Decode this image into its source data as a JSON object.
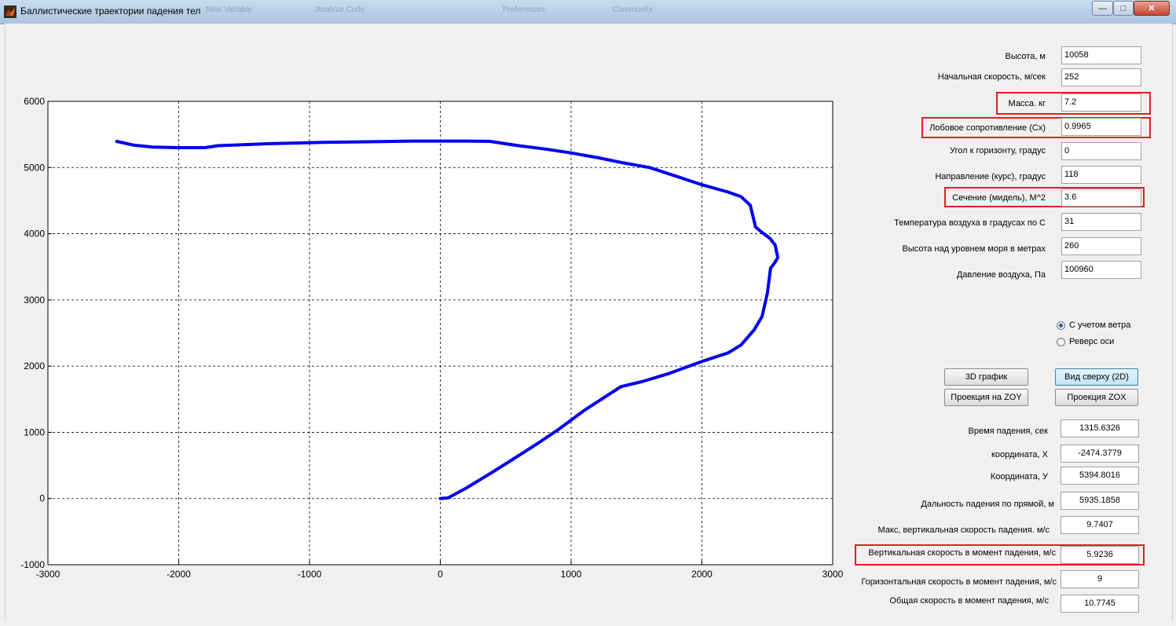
{
  "window": {
    "title": "Баллистические траектории падения тел",
    "bg_menu_items": [
      "New Variable",
      "Analyze Code",
      "Preferences",
      "Community"
    ],
    "controls": {
      "minimize": "—",
      "maximize": "□",
      "close": "✕"
    }
  },
  "inputs": [
    {
      "label": "Высота, м",
      "value": "10058"
    },
    {
      "label": "Начальная скорость, м/сек",
      "value": "252"
    },
    {
      "label": "Масса. кг",
      "value": "7.2"
    },
    {
      "label": "Лобовое сопротивление (Cx)",
      "value": "0.9965"
    },
    {
      "label": "Угол к горизонту, градус",
      "value": "0"
    },
    {
      "label": "Направление  (курс), градус",
      "value": "118"
    },
    {
      "label": "Сечение (мидель), М^2",
      "value": "3.6"
    },
    {
      "label": "Температура воздуха в градусах по С",
      "value": "31"
    },
    {
      "label": "Высота над уровнем моря в метрах",
      "value": "260"
    },
    {
      "label": "Давление воздуха, Па",
      "value": "100960"
    }
  ],
  "options": {
    "wind": {
      "label": "С учетом ветра",
      "checked": true
    },
    "reverse": {
      "label": "Реверс оси",
      "checked": false
    }
  },
  "buttons": {
    "plot3d": "3D график",
    "top_view": "Вид сверху (2D)",
    "zoy": "Проекция на ZOY",
    "zox": "Проекция ZOX"
  },
  "outputs": [
    {
      "label": "Время падения, сек",
      "value": "1315.6326"
    },
    {
      "label": "координата, X",
      "value": "-2474.3779"
    },
    {
      "label": "Координата, У",
      "value": "5394.8016"
    },
    {
      "label": "Дальность падения по прямой, м",
      "value": "5935.1858"
    },
    {
      "label": "Макс,  вертикальная скорость падения. м/с",
      "value": "9.7407"
    },
    {
      "label": "Вертикальная  скорость в момент падения, м/с",
      "value": "5.9236"
    },
    {
      "label": "Горизонтальная скорость в момент падения, м/с",
      "value": "9"
    },
    {
      "label": "Общая скорость в момент падения, м/с",
      "value": "10.7745"
    }
  ],
  "colors": {
    "trajectory": "#0000ee",
    "highlight": "#e02020"
  },
  "chart_data": {
    "type": "line",
    "title": "",
    "xlabel": "",
    "ylabel": "",
    "xlim": [
      -3000,
      3000
    ],
    "ylim": [
      -1000,
      6000
    ],
    "xticks": [
      "-3000",
      "-2000",
      "-1000",
      "0",
      "1000",
      "2000",
      "3000"
    ],
    "yticks": [
      "-1000",
      "0",
      "1000",
      "2000",
      "3000",
      "4000",
      "5000",
      "6000"
    ],
    "grid": true,
    "series": [
      {
        "x": [
          0,
          60,
          200,
          400,
          600,
          750,
          900,
          1100,
          1380,
          1550,
          1750,
          2000,
          2200,
          2300,
          2400,
          2460,
          2500,
          2525,
          2560,
          2580,
          2560,
          2520,
          2460,
          2410,
          2370,
          2300,
          2200,
          2000,
          1800,
          1600,
          1400,
          1200,
          1000,
          800,
          600,
          380,
          200,
          0,
          -200,
          -500,
          -900,
          -1300,
          -1700,
          -1800,
          -2000,
          -2200,
          -2350,
          -2474
        ],
        "y": [
          0,
          10,
          160,
          400,
          650,
          840,
          1040,
          1330,
          1690,
          1770,
          1890,
          2070,
          2200,
          2320,
          2550,
          2750,
          3100,
          3480,
          3570,
          3640,
          3830,
          3930,
          4020,
          4100,
          4430,
          4560,
          4630,
          4740,
          4870,
          5000,
          5070,
          5150,
          5220,
          5280,
          5330,
          5395,
          5400,
          5400,
          5400,
          5390,
          5380,
          5360,
          5330,
          5300,
          5300,
          5310,
          5340,
          5395
        ]
      }
    ]
  }
}
